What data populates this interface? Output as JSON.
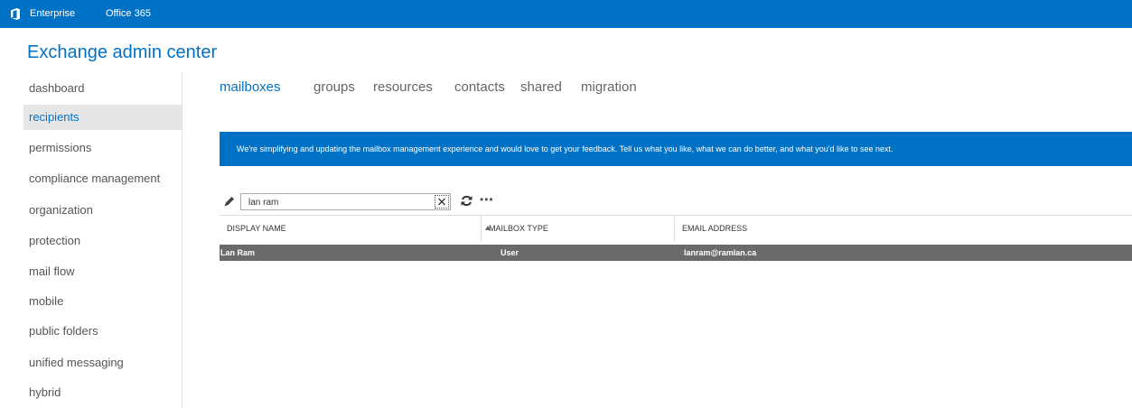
{
  "topbar": {
    "logo_icon": "office-logo-icon",
    "links": [
      "Enterprise",
      "Office 365"
    ],
    "color": "#0072c6"
  },
  "app": {
    "title": "Exchange admin center"
  },
  "sidebar": {
    "active": "recipients",
    "items": [
      {
        "label": "dashboard"
      },
      {
        "label": "recipients"
      },
      {
        "label": "permissions"
      },
      {
        "label": "compliance management"
      },
      {
        "label": "organization"
      },
      {
        "label": "protection"
      },
      {
        "label": "mail flow"
      },
      {
        "label": "mobile"
      },
      {
        "label": "public folders"
      },
      {
        "label": "unified messaging"
      },
      {
        "label": "hybrid"
      }
    ]
  },
  "tabs": {
    "active": "mailboxes",
    "items": [
      {
        "label": "mailboxes"
      },
      {
        "label": "groups"
      },
      {
        "label": "resources"
      },
      {
        "label": "contacts"
      },
      {
        "label": "shared"
      },
      {
        "label": "migration"
      }
    ]
  },
  "banner": {
    "text": "We're simplifying and updating the mailbox management experience and would love to get your feedback. Tell us what you like, what we can do better, and what you'd like to see next."
  },
  "toolbar": {
    "edit_icon": "pencil-icon",
    "search_value": "lan ram",
    "clear_icon": "close-icon",
    "refresh_icon": "refresh-icon",
    "more_label": "•••"
  },
  "grid": {
    "columns": [
      "DISPLAY NAME",
      "MAILBOX TYPE",
      "EMAIL ADDRESS"
    ],
    "sort_icon": "sort-ascending-icon",
    "rows": [
      {
        "display_name": "Lan Ram",
        "mailbox_type": "User",
        "email": "lanram@ramlan.ca",
        "selected": true
      }
    ]
  }
}
